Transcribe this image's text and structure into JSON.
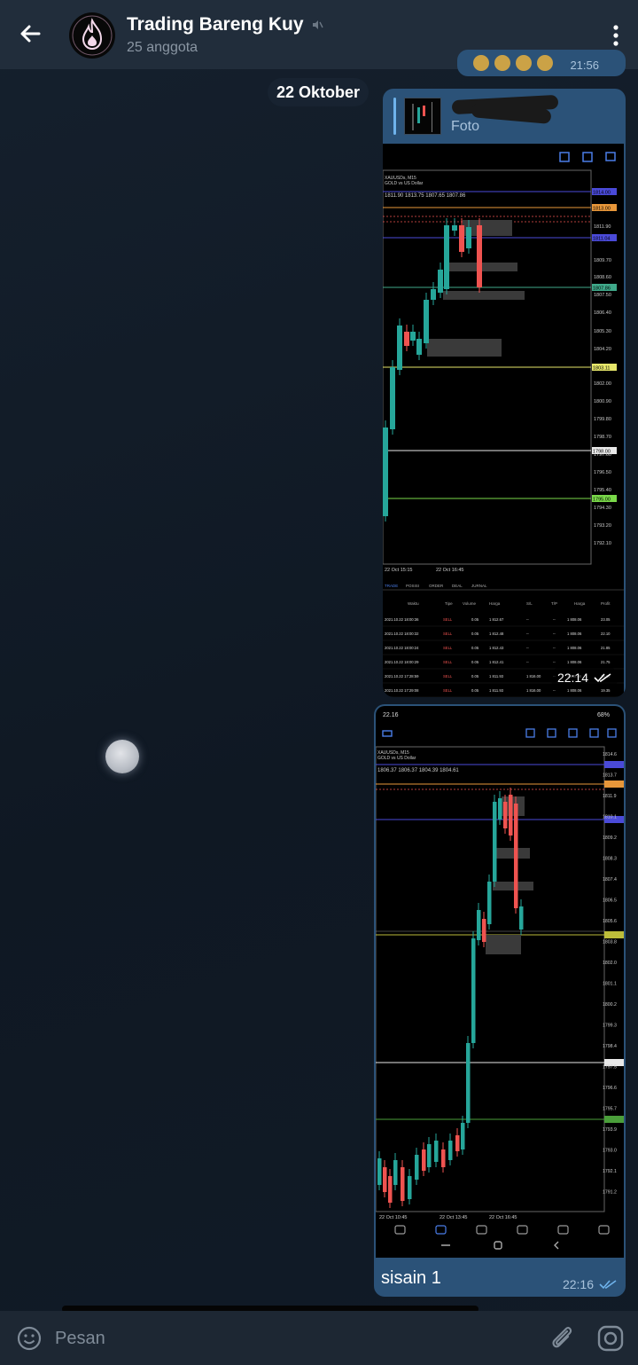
{
  "header": {
    "title": "Trading Bareng Kuy",
    "subtitle": "25 anggota"
  },
  "previous_message": {
    "time": "21:56"
  },
  "date_separator": "22 Oktober",
  "message1": {
    "reply_label": "Foto",
    "time": "22:14",
    "chart": {
      "symbol": "XAUUSDs, M15",
      "description": "GOLD vs US Dollar",
      "ohlc": "1811.90 1813.75 1807.65 1807.86",
      "price_labels": [
        "1811.90",
        "1809.70",
        "1808.60",
        "1807.50",
        "1806.40",
        "1805.30",
        "1804.20",
        "1802.00",
        "1800.90",
        "1799.80",
        "1798.70",
        "1797.60",
        "1796.50",
        "1795.40",
        "1794.30",
        "1793.20",
        "1792.10"
      ],
      "level_tags": [
        {
          "text": "1814.00",
          "color": "#4a4ad8"
        },
        {
          "text": "1813.00",
          "color": "#e8973a"
        },
        {
          "text": "1811.04",
          "color": "#4a4ad8"
        },
        {
          "text": "1807.86",
          "color": "#3fa98a"
        },
        {
          "text": "1803.11",
          "color": "#e6e66a"
        },
        {
          "text": "1798.00",
          "color": "#e8e8e8"
        },
        {
          "text": "1795.00",
          "color": "#7ad94a"
        }
      ],
      "time_labels": [
        "22 Oct 15:15",
        "22 Oct 16:45"
      ],
      "tabs": [
        "TRADE",
        "POSISI",
        "ORDER",
        "DEAL",
        "JURNAL"
      ],
      "table_headers": [
        "Waktu",
        "Tipe",
        "Volume",
        "Harga",
        "S/L",
        "T/P",
        "Harga",
        "Profit"
      ],
      "rows": [
        [
          "2021.10.22 18:00:36",
          "SELL",
          "0.05",
          "1 812.67",
          "--",
          "--",
          "1 808.06",
          "23.05"
        ],
        [
          "2021.10.22 18:00:32",
          "SELL",
          "0.05",
          "1 812.48",
          "--",
          "--",
          "1 808.06",
          "22.10"
        ],
        [
          "2021.10.22 18:00:24",
          "SELL",
          "0.05",
          "1 812.43",
          "--",
          "--",
          "1 808.06",
          "21.85"
        ],
        [
          "2021.10.22 18:00:29",
          "SELL",
          "0.05",
          "1 812.41",
          "--",
          "--",
          "1 808.06",
          "21.75"
        ],
        [
          "2021.10.22 17:28:59",
          "SELL",
          "0.05",
          "1 811.93",
          "1 816.00",
          "--",
          "1 808.06",
          "19.35"
        ],
        [
          "2021.10.22 17:29:08",
          "SELL",
          "0.05",
          "1 811.93",
          "1 816.00",
          "--",
          "1 808.06",
          "19.35"
        ]
      ]
    }
  },
  "message2": {
    "caption": "sisain 1",
    "time": "22:16",
    "chart": {
      "status_time": "22.16",
      "battery": "68%",
      "symbol": "XAUUSDs, M15",
      "description": "GOLD vs US Dollar",
      "ohlc": "1806.37 1806.37 1804.39 1804.61",
      "price_labels": [
        "1814.6",
        "1813.7",
        "1811.9",
        "1810.1",
        "1809.2",
        "1808.3",
        "1807.4",
        "1806.5",
        "1805.6",
        "1803.8",
        "1802.0",
        "1801.1",
        "1800.2",
        "1799.3",
        "1798.4",
        "1797.5",
        "1796.6",
        "1795.7",
        "1793.9",
        "1793.0",
        "1792.1",
        "1791.2"
      ],
      "time_labels": [
        "22 Oct 10:45",
        "22 Oct 13:45",
        "22 Oct 16:45"
      ]
    }
  },
  "input": {
    "placeholder": "Pesan"
  },
  "colors": {
    "header_bg": "#212d3b",
    "bubble_out": "#2b5278",
    "bull": "#26a69a",
    "bear": "#ef5350"
  }
}
